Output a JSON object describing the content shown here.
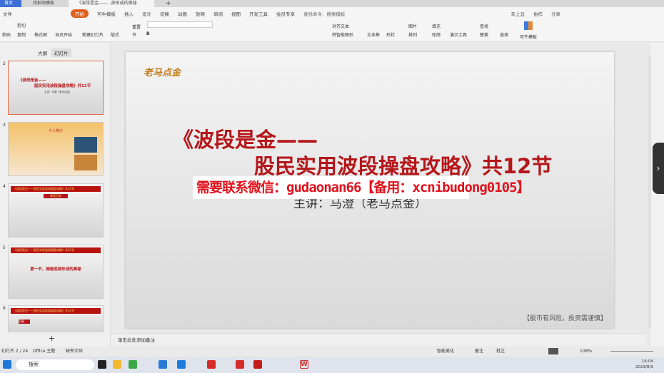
{
  "tabs": [
    {
      "label": "首页"
    },
    {
      "label": "找稻壳模板"
    },
    {
      "label": "《波段是金——...部形成的奥秘"
    }
  ],
  "menu": {
    "file": "文件",
    "items": [
      "开始",
      "可牛模板",
      "插入",
      "设计",
      "切换",
      "动画",
      "放映",
      "审阅",
      "视图",
      "开发工具",
      "会员专享"
    ],
    "search": "查找命令、搜索模板",
    "cloud": "未上云",
    "collab": "协作",
    "share": "分享"
  },
  "ribbon": {
    "paste": "粘贴",
    "cut": "剪切",
    "copy": "复制",
    "format_painter": "格式刷",
    "play_from_current": "当页开始",
    "new_slide": "新建幻灯片",
    "layout": "版式",
    "section": "节",
    "reset": "重置",
    "align_text": "对齐文本",
    "smartart": "转智能图形",
    "textbox": "文本框",
    "shape": "形状",
    "picture": "图片",
    "arrange": "排列",
    "fill": "填充",
    "outline": "轮廓",
    "present_tools": "演示工具",
    "find": "查找",
    "replace": "替换",
    "select": "选择",
    "template": "可牛模板"
  },
  "panel": {
    "tab_outline": "大纲",
    "tab_slides": "幻灯片",
    "thumbs": [
      {
        "num": "2",
        "title1": "《波段是金——",
        "title2": "股民实用波段操盘攻略》共12节",
        "sub": "主讲：马澄（老马点金）"
      },
      {
        "num": "3",
        "title": "个人简介"
      },
      {
        "num": "4",
        "header": "《波段是金——股民实用波段操盘攻略》共12节",
        "badge": "课程目录"
      },
      {
        "num": "5",
        "header": "《波段是金——股民实用波段操盘攻略》共12节",
        "body": "第一节、揭秘底部形成的奥秘"
      },
      {
        "num": "6",
        "header": "《波段是金——股民实用波段操盘攻略》共12节",
        "badge": "目录"
      }
    ]
  },
  "slide": {
    "logo": "老马点金",
    "title_line1": "《波段是金——",
    "title_line2": "股民实用波段操盘攻略》共12节",
    "watermark": "需要联系微信：gudaonan66【备用：xcnibudong0105】",
    "presenter": "主讲：马澄（老马点金）",
    "risk": "【股市有风险，投资需谨慎】"
  },
  "notes": {
    "placeholder": "单击此处添加备注"
  },
  "status": {
    "slide_count": "幻灯片 2 / 24",
    "theme": "Office 主题",
    "missing_fonts": "缺失字体",
    "smart_beautify": "智能美化",
    "notes": "备注",
    "comments": "批注",
    "zoom": "108%"
  },
  "taskbar": {
    "search": "搜索",
    "time": "16:04",
    "date": "2023/8/9"
  }
}
